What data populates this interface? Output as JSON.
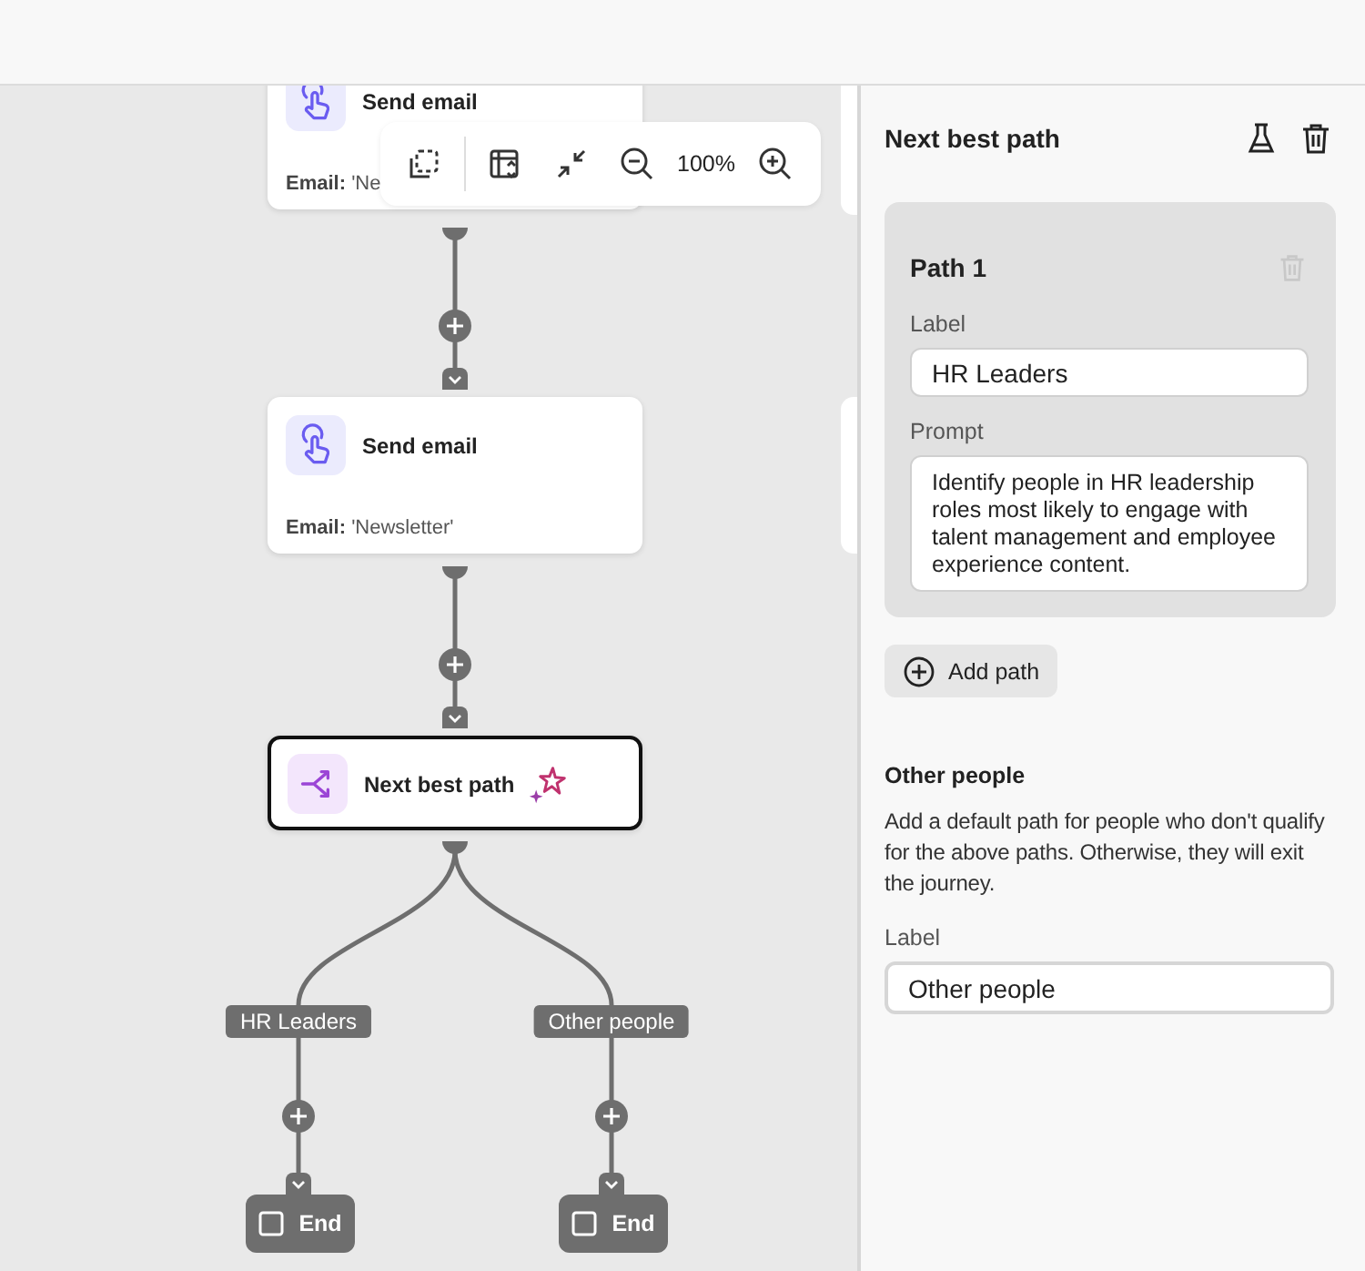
{
  "toolbar": {
    "zoom": "100%"
  },
  "nodes": [
    {
      "kind": "email",
      "title": "Send email",
      "detail_label": "Email:",
      "detail_value": "'Ne"
    },
    {
      "kind": "email",
      "title": "Send email",
      "detail_label": "Email:",
      "detail_value": "'Newsletter'"
    },
    {
      "kind": "nbp",
      "title": "Next best path",
      "selected": true
    }
  ],
  "branches": [
    {
      "label": "HR Leaders",
      "end": "End"
    },
    {
      "label": "Other people",
      "end": "End"
    }
  ],
  "panel": {
    "title": "Next best path",
    "paths": [
      {
        "title": "Path 1",
        "delete_disabled": true,
        "label_caption": "Label",
        "label_value": "HR Leaders",
        "prompt_caption": "Prompt",
        "prompt_value": "Identify people in HR leadership roles most likely to engage with talent management and employee experience content."
      }
    ],
    "add_path": "Add path",
    "other": {
      "heading": "Other people",
      "description": "Add a default path for people who don't qualify for the above paths. Otherwise, they will exit the journey.",
      "label_caption": "Label",
      "label_value": "Other people"
    }
  }
}
